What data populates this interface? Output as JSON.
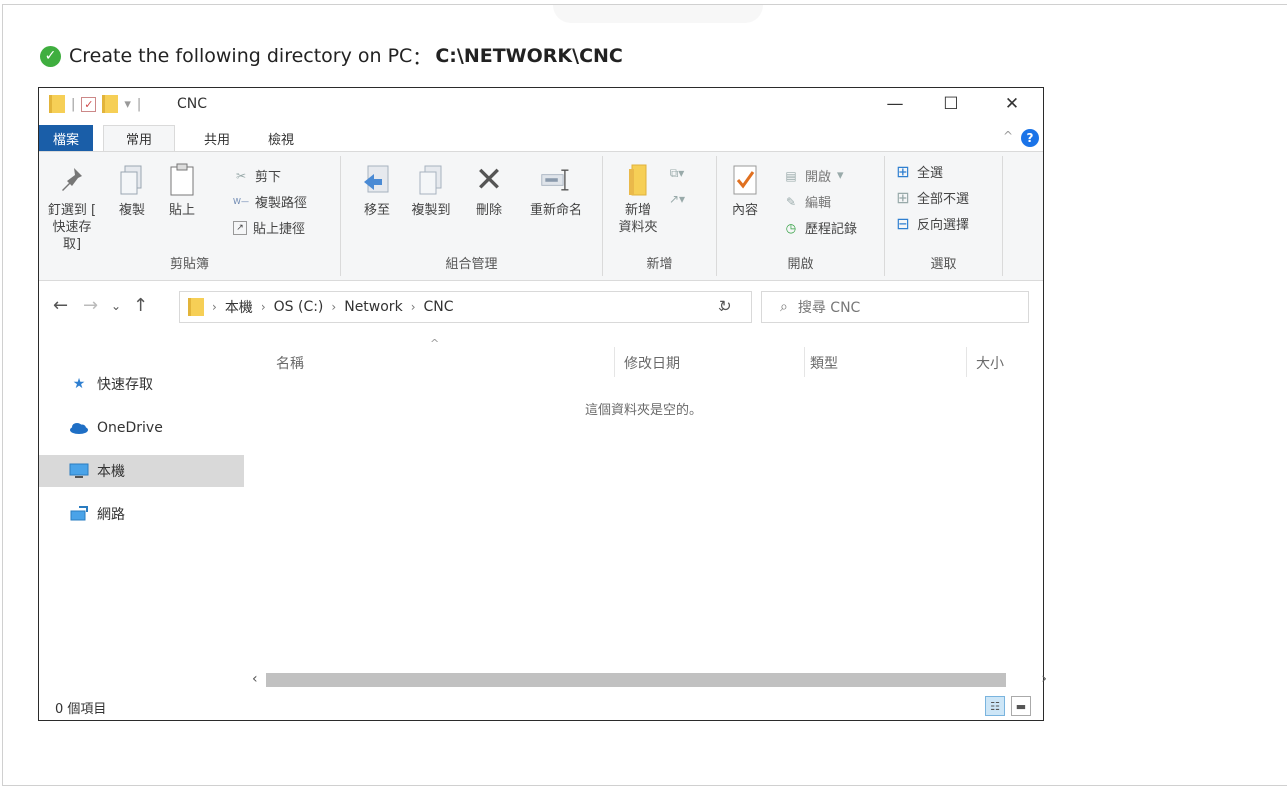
{
  "instruction": {
    "text": "Create the following directory on PC ",
    "colon": "：",
    "path": "C:\\NETWORK\\CNC"
  },
  "window": {
    "title": "CNC",
    "controls": {
      "minimize": "—",
      "maximize": "☐",
      "close": "✕"
    }
  },
  "tabs": [
    "檔案",
    "常用",
    "共用",
    "檢視"
  ],
  "ribbon": {
    "clipboard": {
      "label": "剪貼簿",
      "pin": [
        "釘選到 [",
        "快速存取]"
      ],
      "copy": "複製",
      "paste": "貼上",
      "cut": "剪下",
      "copy_path": "複製路徑",
      "paste_shortcut": "貼上捷徑"
    },
    "organize": {
      "label": "組合管理",
      "move_to": "移至",
      "copy_to": "複製到",
      "delete": "刪除",
      "rename": "重新命名"
    },
    "new": {
      "label": "新增",
      "new_folder": [
        "新增",
        "資料夾"
      ]
    },
    "open": {
      "label": "開啟",
      "properties": "內容",
      "open": "開啟",
      "edit": "編輯",
      "history": "歷程記錄"
    },
    "select": {
      "label": "選取",
      "select_all": "全選",
      "select_none": "全部不選",
      "invert": "反向選擇"
    }
  },
  "address": {
    "crumbs": [
      "本機",
      "OS (C:)",
      "Network",
      "CNC"
    ],
    "search_placeholder": "搜尋 CNC"
  },
  "sidebar": {
    "items": [
      {
        "label": "快速存取",
        "icon": "star-icon"
      },
      {
        "label": "OneDrive",
        "icon": "cloud-icon"
      },
      {
        "label": "本機",
        "icon": "computer-icon",
        "selected": true
      },
      {
        "label": "網路",
        "icon": "network-icon"
      }
    ]
  },
  "columns": [
    "名稱",
    "修改日期",
    "類型",
    "大小"
  ],
  "empty_message": "這個資料夾是空的。",
  "status": {
    "count_text": "0 個項目"
  }
}
